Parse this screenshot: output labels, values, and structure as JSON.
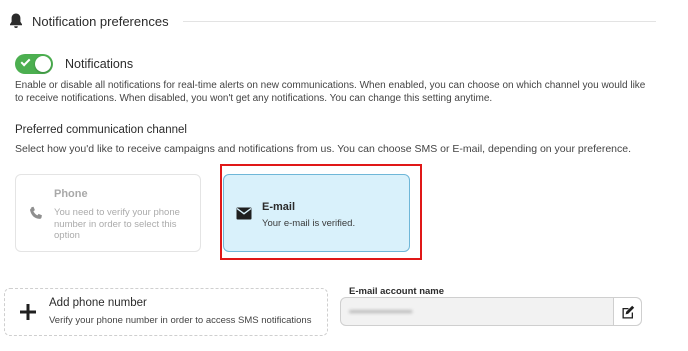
{
  "section": {
    "title": "Notification preferences",
    "icon": "bell-icon"
  },
  "notifications": {
    "label": "Notifications",
    "enabled": true,
    "toggle_color": "#4caf50",
    "description": "Enable or disable all notifications for real-time alerts on new communications. When enabled, you can choose on which channel you would like to receive notifications. When disabled, you won't get any notifications. You can change this setting anytime."
  },
  "preferred_channel": {
    "title": "Preferred communication channel",
    "description": "Select how you'd like to receive campaigns and notifications from us. You can choose SMS or E-mail, depending on your preference.",
    "options": [
      {
        "title": "Phone",
        "subtitle": "You need to verify your phone number in order to select this option",
        "icon": "phone-icon",
        "state": "disabled"
      },
      {
        "title": "E-mail",
        "subtitle": "Your e-mail is verified.",
        "icon": "envelope-icon",
        "state": "selected",
        "highlight_color": "#e01818"
      }
    ]
  },
  "add_phone": {
    "title": "Add phone number",
    "subtitle": "Verify your phone number in order to access SMS notifications",
    "icon": "plus-icon"
  },
  "email_account": {
    "label": "E-mail account name",
    "value": "•••••••••••••••••••••",
    "edit_icon": "edit-icon"
  }
}
